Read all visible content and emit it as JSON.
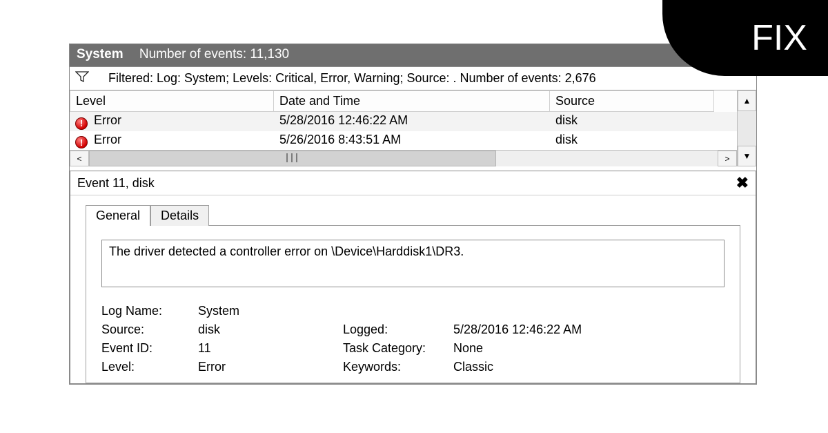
{
  "badge": {
    "label": "FIX"
  },
  "title_bar": {
    "log_name": "System",
    "events_label": "Number of events: 11,130"
  },
  "filter_row": {
    "text": "Filtered: Log: System; Levels: Critical, Error, Warning; Source: . Number of events: 2,676"
  },
  "columns": {
    "level": "Level",
    "date_time": "Date and Time",
    "source": "Source"
  },
  "rows": [
    {
      "level": "Error",
      "date_time": "5/28/2016 12:46:22 AM",
      "source": "disk"
    },
    {
      "level": "Error",
      "date_time": "5/26/2016 8:43:51 AM",
      "source": "disk"
    }
  ],
  "hscroll_grip": "III",
  "detail": {
    "title": "Event 11, disk",
    "tabs": {
      "general": "General",
      "details": "Details"
    },
    "message": "The driver detected a controller error on \\Device\\Harddisk1\\DR3.",
    "props": {
      "log_name_label": "Log Name:",
      "log_name_value": "System",
      "source_label": "Source:",
      "source_value": "disk",
      "logged_label": "Logged:",
      "logged_value": "5/28/2016 12:46:22 AM",
      "event_id_label": "Event ID:",
      "event_id_value": "11",
      "task_category_label": "Task Category:",
      "task_category_value": "None",
      "level_label": "Level:",
      "level_value": "Error",
      "keywords_label": "Keywords:",
      "keywords_value": "Classic"
    }
  }
}
